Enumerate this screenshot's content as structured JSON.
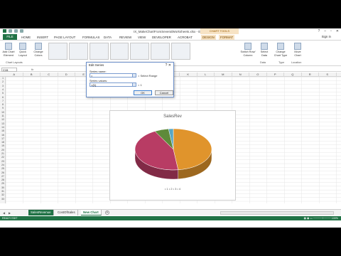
{
  "window": {
    "title": "IX_MakeChartFromSeveralWorksheets.xlsx - Excel",
    "context_tools": "CHART TOOLS",
    "controls": [
      "?",
      "–",
      "▫",
      "✕"
    ]
  },
  "ribbon_tabs": [
    {
      "label": "FILE"
    },
    {
      "label": "HOME"
    },
    {
      "label": "INSERT"
    },
    {
      "label": "PAGE LAYOUT"
    },
    {
      "label": "FORMULAS"
    },
    {
      "label": "DATA"
    },
    {
      "label": "REVIEW"
    },
    {
      "label": "VIEW"
    },
    {
      "label": "DEVELOPER"
    },
    {
      "label": "ACROBAT"
    },
    {
      "label": "DESIGN"
    },
    {
      "label": "FORMAT"
    }
  ],
  "signin": "Sign in",
  "ribbon": {
    "add_chart_element": "Add Chart Element",
    "quick_layout": "Quick Layout",
    "change_colors": "Change Colors",
    "chart_layouts_group": "Chart Layouts",
    "switch_row_column": "Switch Row/ Column",
    "select_data": "Select Data",
    "change_chart_type": "Change Chart Type",
    "move_chart": "Move Chart",
    "group_data": "Data",
    "group_type": "Type",
    "group_location": "Location"
  },
  "formula_bar": {
    "name_box": "C15",
    "fx": "fx"
  },
  "columns": [
    "A",
    "B",
    "C",
    "D",
    "E",
    "F",
    "G",
    "H",
    "I",
    "J",
    "K",
    "L",
    "M",
    "N",
    "O",
    "P",
    "Q",
    "R",
    "S"
  ],
  "rows": [
    "1",
    "2",
    "3",
    "4",
    "5",
    "6",
    "7",
    "8",
    "9",
    "10",
    "11",
    "12",
    "13",
    "14",
    "15",
    "16",
    "17",
    "18",
    "19",
    "20",
    "21",
    "22",
    "23",
    "24",
    "25",
    "26",
    "27",
    "28",
    "29",
    "30",
    "31",
    "32",
    "33"
  ],
  "dialog": {
    "title": "Edit Series",
    "close": "?  ✕",
    "series_name_label": "Series name:",
    "series_name_value": "=",
    "series_name_note": "= Select Range",
    "series_values_label": "Series values:",
    "series_values_value": "={1}",
    "series_values_note": "= 1",
    "ok": "OK",
    "cancel": "Cancel"
  },
  "chart_data": {
    "type": "pie",
    "title": "SalesRev",
    "categories": [
      "1",
      "2",
      "3",
      "4"
    ],
    "values": [
      48,
      44,
      6,
      2
    ],
    "colors": [
      "#e0942c",
      "#b83c64",
      "#5e8a3a",
      "#58a7c5"
    ],
    "legend": "• 1  • 2  • 3  • 4",
    "legend_position": "bottom"
  },
  "sheet_tabs": [
    {
      "label": "SalesRevenue",
      "state": "green"
    },
    {
      "label": "CostOfSales",
      "state": "normal"
    },
    {
      "label": "New Chart",
      "state": "active"
    }
  ],
  "status": {
    "left": "READY   EDIT",
    "right": "▦  ▣  ▭   ─────+────   100%"
  }
}
